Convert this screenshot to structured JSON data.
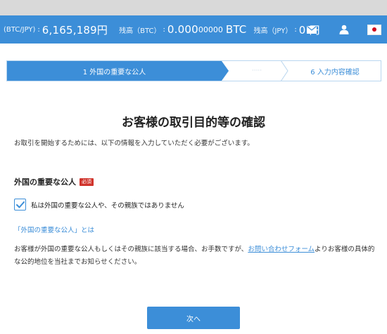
{
  "header": {
    "pair_label": "(BTC/JPY)",
    "separator": ":",
    "price": "6,165,189円",
    "btc_balance_label": "残高（BTC）",
    "btc_balance_main": "0.000",
    "btc_balance_digits": "00000",
    "btc_unit": "BTC",
    "jpy_balance_label": "残高（JPY）",
    "jpy_balance": "0 円",
    "icons": [
      "mail-icon",
      "user-icon",
      "japan-flag-icon"
    ]
  },
  "progress": {
    "step1": "1 外国の重要な公人",
    "dots": "·····",
    "step6": "6 入力内容確認"
  },
  "page": {
    "title": "お客様の取引目的等の確認",
    "intro": "お取引を開始するためには、以下の情報を入力していただく必要がございます。"
  },
  "pep_section": {
    "heading": "外国の重要な公人",
    "required_badge": "必須",
    "checkbox_label": "私は外国の重要な公人や、その親族ではありません",
    "checkbox_checked": true,
    "info_link": "「外国の重要な公人」とは",
    "notice_before": "お客様が外国の重要な公人もしくはその親族に該当する場合、お手数ですが、",
    "notice_link": "お問い合わせフォーム",
    "notice_after": "よりお客様の具体的な公的地位を当社までお知らせください。"
  },
  "next_button": "次へ",
  "colors": {
    "accent": "#3c8ed8",
    "required": "#d0342c"
  }
}
